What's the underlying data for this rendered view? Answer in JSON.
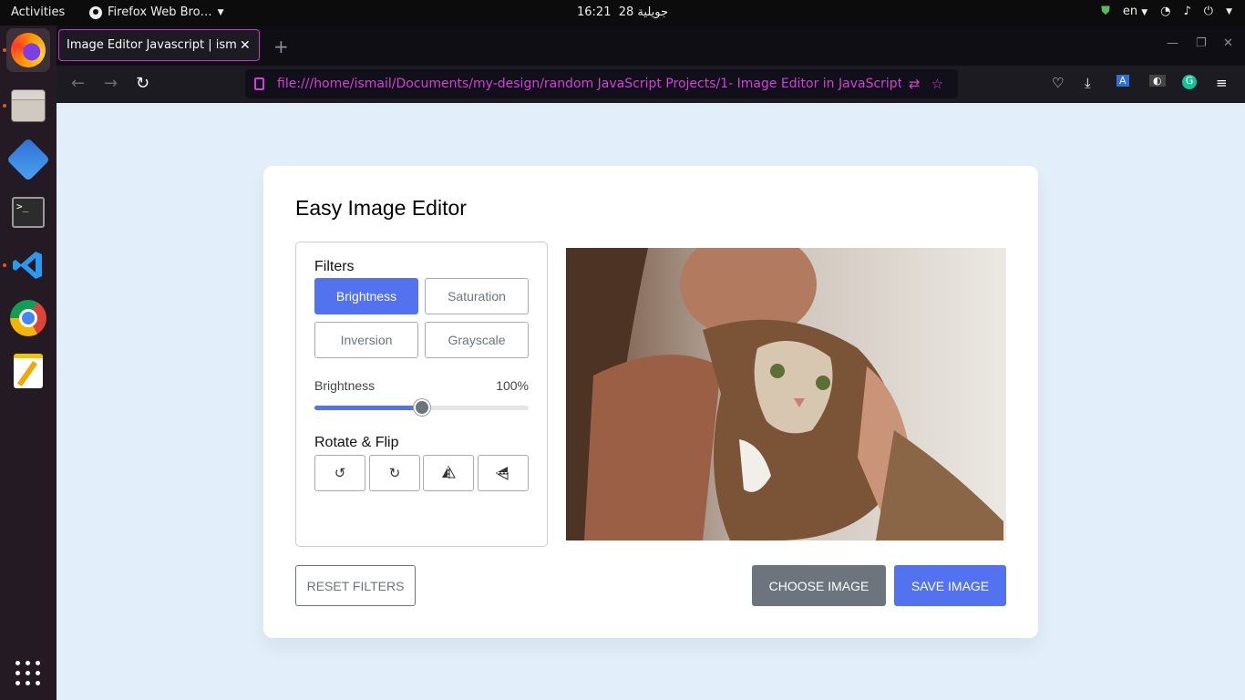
{
  "topbar": {
    "activities": "Activities",
    "app_name": "Firefox Web Bro…",
    "clock_time": "16:21",
    "clock_date": "28 جويلية",
    "language": "en"
  },
  "browser": {
    "tab_title": "Image Editor Javascript | ism",
    "url": "file:///home/ismail/Documents/my-design/random JavaScript Projects/1- Image Editor in JavaScript"
  },
  "editor": {
    "title": "Easy Image Editor",
    "filters_heading": "Filters",
    "filters": [
      {
        "label": "Brightness",
        "active": true
      },
      {
        "label": "Saturation",
        "active": false
      },
      {
        "label": "Inversion",
        "active": false
      },
      {
        "label": "Grayscale",
        "active": false
      }
    ],
    "slider": {
      "name": "Brightness",
      "value_text": "100%",
      "fraction": 0.5
    },
    "rotate_heading": "Rotate & Flip",
    "rotate_icons": [
      "rotate-left-icon",
      "rotate-right-icon",
      "flip-horizontal-icon",
      "flip-vertical-icon"
    ],
    "buttons": {
      "reset": "Reset Filters",
      "choose": "Choose Image",
      "save": "Save Image"
    }
  },
  "colors": {
    "accent": "#5372f0",
    "secondary": "#6c757d",
    "page_bg": "#e2effb",
    "url_text": "#d240d6"
  }
}
